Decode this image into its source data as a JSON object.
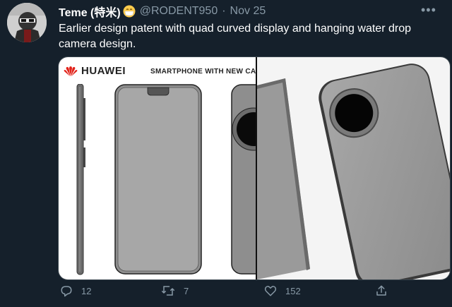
{
  "tweet": {
    "author_name": "Teme (特米)",
    "author_handle": "@RODENT950",
    "separator": "·",
    "date": "Nov 25",
    "text": "Earlier design patent with quad curved display and hanging water drop camera design.",
    "more_icon": "more-horizontal-icon"
  },
  "media": {
    "left_image": {
      "brand": "HUAWEI",
      "caption": "SMARTPHONE WITH NEW CAMER"
    },
    "right_image": {}
  },
  "actions": {
    "reply_count": "12",
    "retweet_count": "7",
    "like_count": "152",
    "icons": [
      "reply-icon",
      "retweet-icon",
      "like-icon",
      "share-icon"
    ]
  },
  "colors": {
    "background": "#15202b",
    "secondary_text": "#8899a6",
    "primary_text": "#ffffff",
    "huawei_red": "#e2231a"
  }
}
